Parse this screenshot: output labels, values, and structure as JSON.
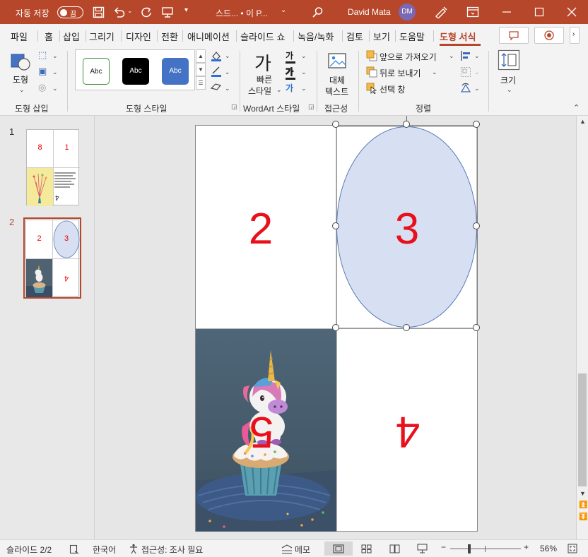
{
  "titlebar": {
    "autosave_label": "자동 저장",
    "autosave_state": "끔",
    "doc_title": "스드... • 이 P...",
    "user_name": "David Mata",
    "user_initials": "DM",
    "bg_color": "#b7472a"
  },
  "tabs": [
    {
      "label": "파일"
    },
    {
      "label": "홈"
    },
    {
      "label": "삽입"
    },
    {
      "label": "그리기"
    },
    {
      "label": "디자인"
    },
    {
      "label": "전환"
    },
    {
      "label": "애니메이션"
    },
    {
      "label": "슬라이드 쇼"
    },
    {
      "label": "녹음/녹화"
    },
    {
      "label": "검토"
    },
    {
      "label": "보기"
    },
    {
      "label": "도움말"
    },
    {
      "label": "도형 서식"
    }
  ],
  "ribbon": {
    "groups": {
      "insert_shapes": "도형 삽입",
      "shape_styles": "도형 스타일",
      "wordart_styles": "WordArt 스타일",
      "accessibility": "접근성",
      "arrange": "정렬"
    },
    "shapes_label": "도형",
    "style_swatches": [
      "Abc",
      "Abc",
      "Abc"
    ],
    "quick_styles_label": "빠른 스타일",
    "quick_styles_line1": "빠른",
    "quick_styles_line2": "스타일",
    "wordart_letter": "가",
    "alt_text_line1": "대체",
    "alt_text_line2": "텍스트",
    "bring_forward": "앞으로 가져오기",
    "send_backward": "뒤로 보내기",
    "selection_pane": "선택 창",
    "size_label": "크기"
  },
  "slides_pane": {
    "slides": [
      {
        "number": "1",
        "quadrants": [
          "8",
          "1",
          "",
          "4"
        ]
      },
      {
        "number": "2",
        "quadrants": [
          "2",
          "3",
          "",
          "4"
        ]
      }
    ]
  },
  "slide": {
    "numbers": [
      "2",
      "3",
      "5",
      "4"
    ],
    "ellipse_fill": "#d6e0f2",
    "number_color": "#e8101c"
  },
  "statusbar": {
    "slide_info": "슬라이드 2/2",
    "language": "한국어",
    "accessibility": "접근성: 조사 필요",
    "notes": "메모",
    "zoom": "56%"
  }
}
